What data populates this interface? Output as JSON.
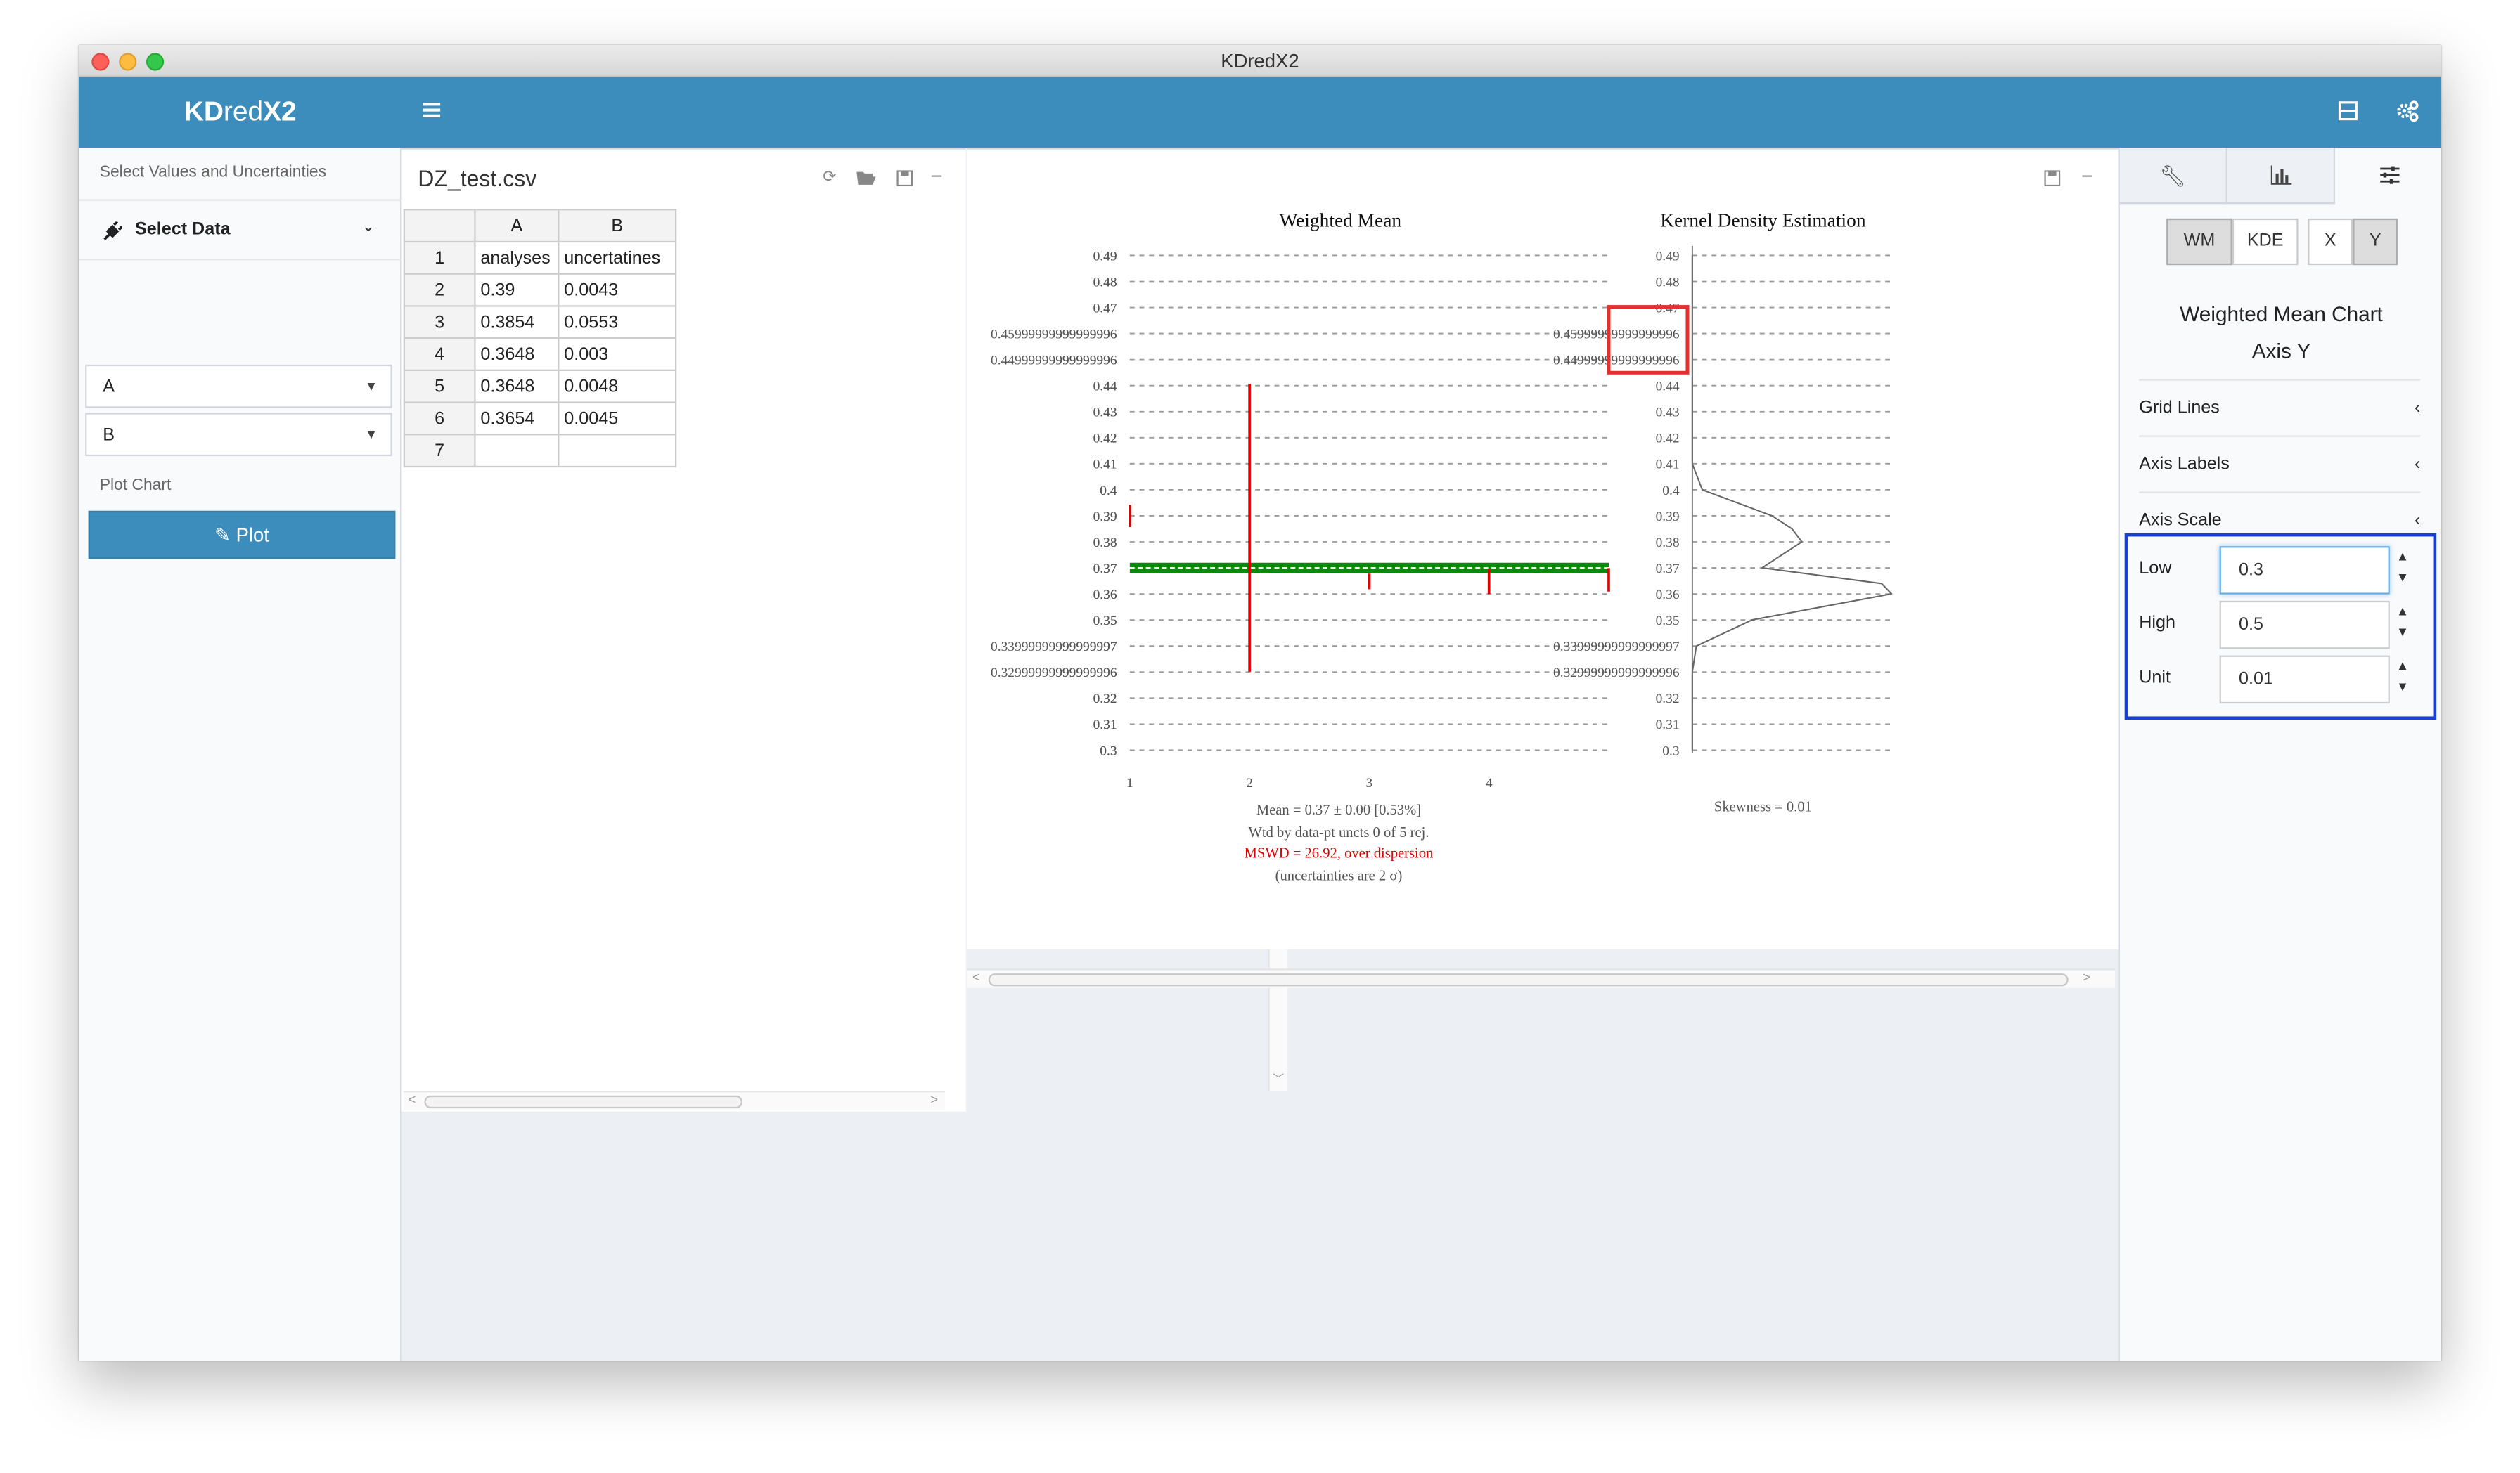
{
  "window": {
    "title": "KDredX2"
  },
  "header": {
    "logo_kd": "KD",
    "logo_red": "red",
    "logo_x2": "X2"
  },
  "sidebar": {
    "select_values_label": "Select Values and Uncertainties",
    "select_data_label": "Select Data",
    "value_select": "A",
    "uncertainty_select": "B",
    "plot_chart_label": "Plot Chart",
    "plot_button": "Plot"
  },
  "data_table": {
    "filename": "DZ_test.csv",
    "column_headers": [
      "A",
      "B"
    ],
    "rows": [
      [
        "1",
        "analyses",
        "uncertatines"
      ],
      [
        "2",
        "0.39",
        "0.0043"
      ],
      [
        "3",
        "0.3854",
        "0.0553"
      ],
      [
        "4",
        "0.3648",
        "0.003"
      ],
      [
        "5",
        "0.3648",
        "0.0048"
      ],
      [
        "6",
        "0.3654",
        "0.0045"
      ],
      [
        "7",
        "",
        ""
      ]
    ]
  },
  "chart_data": [
    {
      "type": "line",
      "title": "Weighted Mean",
      "y_tick_labels": [
        "0.49",
        "0.48",
        "0.47",
        "0.45999999999999996",
        "0.44999999999999996",
        "0.44",
        "0.43",
        "0.42",
        "0.41",
        "0.4",
        "0.39",
        "0.38",
        "0.37",
        "0.36",
        "0.35",
        "0.33999999999999997",
        "0.32999999999999996",
        "0.32",
        "0.31",
        "0.3"
      ],
      "x_tick_labels": [
        "1",
        "2",
        "3",
        "4"
      ],
      "ylim": [
        0.3,
        0.49
      ],
      "x": [
        1,
        2,
        3,
        4,
        5
      ],
      "values": [
        0.39,
        0.3854,
        0.3648,
        0.3648,
        0.3654
      ],
      "uncertainties": [
        0.0043,
        0.0553,
        0.003,
        0.0048,
        0.0045
      ],
      "mean": 0.37,
      "grid": true,
      "colors": {
        "error_bars": "#e00000",
        "mean_band": "#0d8a0d"
      },
      "annotations": {
        "mean": "Mean = 0.37 ± 0.00 [0.53%]",
        "wtd": "Wtd by data-pt uncts 0 of 5 rej.",
        "mswd": "MSWD = 26.92, over dispersion",
        "uncert": "(uncertainties are 2 σ)"
      }
    },
    {
      "type": "line",
      "title": "Kernel Density Estimation",
      "y_tick_labels": [
        "0.49",
        "0.48",
        "0.47",
        "0.45999999999999996",
        "0.44999999999999996",
        "0.44",
        "0.43",
        "0.42",
        "0.41",
        "0.4",
        "0.39",
        "0.38",
        "0.37",
        "0.36",
        "0.35",
        "0.33999999999999997",
        "0.32999999999999996",
        "0.32",
        "0.31",
        "0.3"
      ],
      "ylim": [
        0.3,
        0.49
      ],
      "density": {
        "y": [
          0.3,
          0.33,
          0.34,
          0.35,
          0.36,
          0.364,
          0.37,
          0.38,
          0.385,
          0.39,
          0.4,
          0.41,
          0.44,
          0.49
        ],
        "d": [
          0,
          0,
          0.02,
          0.3,
          1.0,
          0.95,
          0.35,
          0.55,
          0.5,
          0.4,
          0.05,
          0,
          0,
          0
        ]
      },
      "grid": true,
      "annotation": "Skewness = 0.01"
    }
  ],
  "right_panel": {
    "tabs": [
      "wrench-icon",
      "bar-chart-icon",
      "sliders-icon"
    ],
    "toggle_buttons": [
      "WM",
      "KDE",
      "X",
      "Y"
    ],
    "section_title_1": "Weighted Mean Chart",
    "section_title_2": "Axis Y",
    "accordion": [
      "Grid Lines",
      "Axis Labels",
      "Axis Scale"
    ],
    "axis_scale": {
      "low_label": "Low",
      "low_value": "0.3",
      "high_label": "High",
      "high_value": "0.5",
      "unit_label": "Unit",
      "unit_value": "0.01"
    }
  }
}
